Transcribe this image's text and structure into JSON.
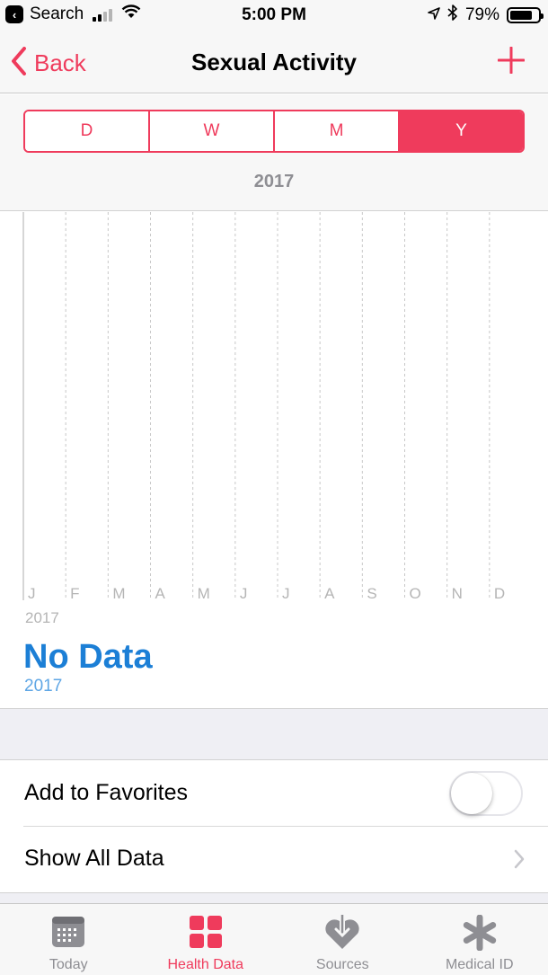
{
  "status_bar": {
    "back_app": "Search",
    "time": "5:00 PM",
    "battery": "79%",
    "battery_level": 0.79
  },
  "nav": {
    "back_label": "Back",
    "title": "Sexual Activity"
  },
  "segments": [
    {
      "label": "D",
      "active": false
    },
    {
      "label": "W",
      "active": false
    },
    {
      "label": "M",
      "active": false
    },
    {
      "label": "Y",
      "active": true
    }
  ],
  "period_label": "2017",
  "chart_data": {
    "type": "bar",
    "categories": [
      "J",
      "F",
      "M",
      "A",
      "M",
      "J",
      "J",
      "A",
      "S",
      "O",
      "N",
      "D"
    ],
    "values": [],
    "year_label": "2017",
    "grid": true
  },
  "summary": {
    "value": "No Data",
    "period": "2017"
  },
  "list": {
    "favorites_label": "Add to Favorites",
    "favorites_on": false,
    "show_all_label": "Show All Data"
  },
  "tabs": [
    {
      "label": "Today",
      "icon": "calendar-icon",
      "active": false
    },
    {
      "label": "Health Data",
      "icon": "grid-icon",
      "active": true
    },
    {
      "label": "Sources",
      "icon": "heart-download-icon",
      "active": false
    },
    {
      "label": "Medical ID",
      "icon": "asterisk-icon",
      "active": false
    }
  ],
  "colors": {
    "accent": "#ef3b5c",
    "data_blue": "#1c7fd6",
    "inactive_gray": "#8e8e93"
  }
}
